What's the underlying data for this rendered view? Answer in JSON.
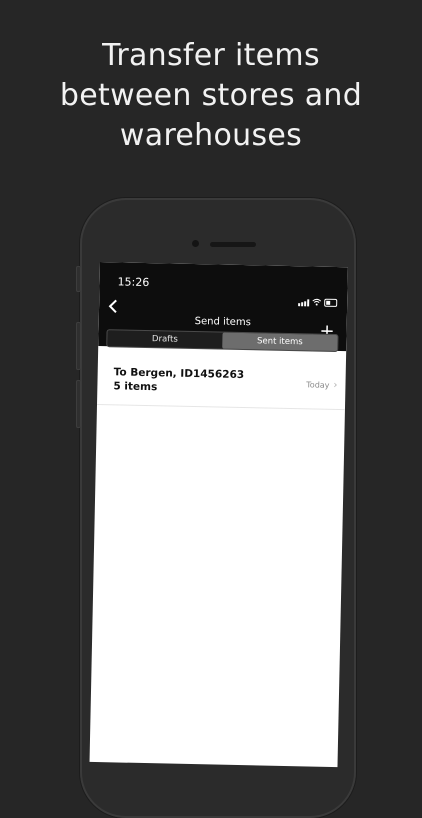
{
  "headline": {
    "line1": "Transfer items",
    "line2": "between stores and",
    "line3": "warehouses"
  },
  "status_bar": {
    "time": "15:26",
    "icons": [
      "signal-icon",
      "wifi-icon",
      "battery-icon"
    ]
  },
  "nav": {
    "title": "Send items",
    "back_icon": "chevron-left-icon",
    "add_icon": "plus-icon",
    "add_glyph": "+"
  },
  "tabs": [
    {
      "label": "Drafts",
      "active": false
    },
    {
      "label": "Sent items",
      "active": true
    }
  ],
  "transfers": [
    {
      "title": "To Bergen, ID1456263",
      "subtitle": "5 items",
      "date": "Today",
      "chevron": "›"
    }
  ],
  "colors": {
    "background": "#262626",
    "topbar": "#0d0d0d",
    "active_tab": "#6d6d6d"
  }
}
